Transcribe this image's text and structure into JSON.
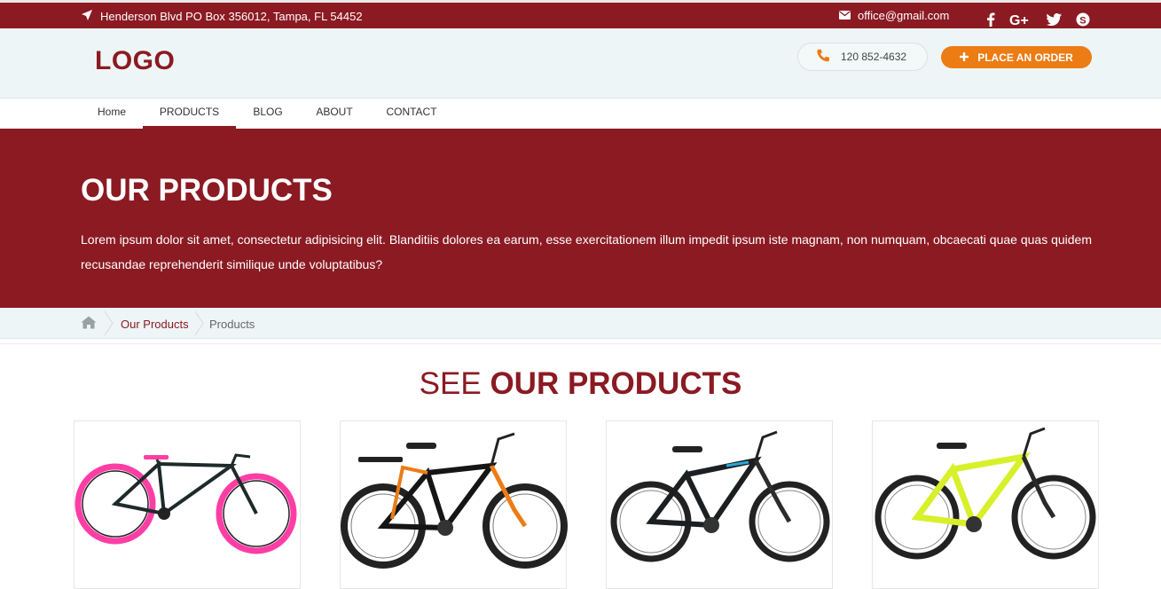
{
  "topbar": {
    "address": "Henderson Blvd PO Box 356012, Tampa, FL 54452",
    "email": "office@gmail.com",
    "social": [
      "facebook-icon",
      "google-plus-icon",
      "twitter-icon",
      "skype-icon"
    ]
  },
  "header": {
    "logo": "LOGO",
    "phone": "120 852-4632",
    "order_label": "PLACE AN ORDER"
  },
  "nav": {
    "items": [
      {
        "label": "Home"
      },
      {
        "label": "PRODUCTS"
      },
      {
        "label": "BLOG"
      },
      {
        "label": "ABOUT"
      },
      {
        "label": "CONTACT"
      }
    ],
    "active": "PRODUCTS"
  },
  "hero": {
    "title": "OUR PRODUCTS",
    "text": "Lorem ipsum dolor sit amet, consectetur adipisicing elit. Blanditiis dolores ea earum, esse exercitationem illum impedit ipsum iste magnam, non numquam, obcaecati quae quas quidem recusandae reprehenderit similique unde voluptatibus?"
  },
  "breadcrumb": {
    "items": [
      "Our Products",
      "Products"
    ]
  },
  "section": {
    "title_light": "SEE",
    "title_bold": "OUR PRODUCTS"
  },
  "colors": {
    "brand": "#8b1a22",
    "accent": "#ec7c14",
    "light_bg": "#eef5f6"
  }
}
